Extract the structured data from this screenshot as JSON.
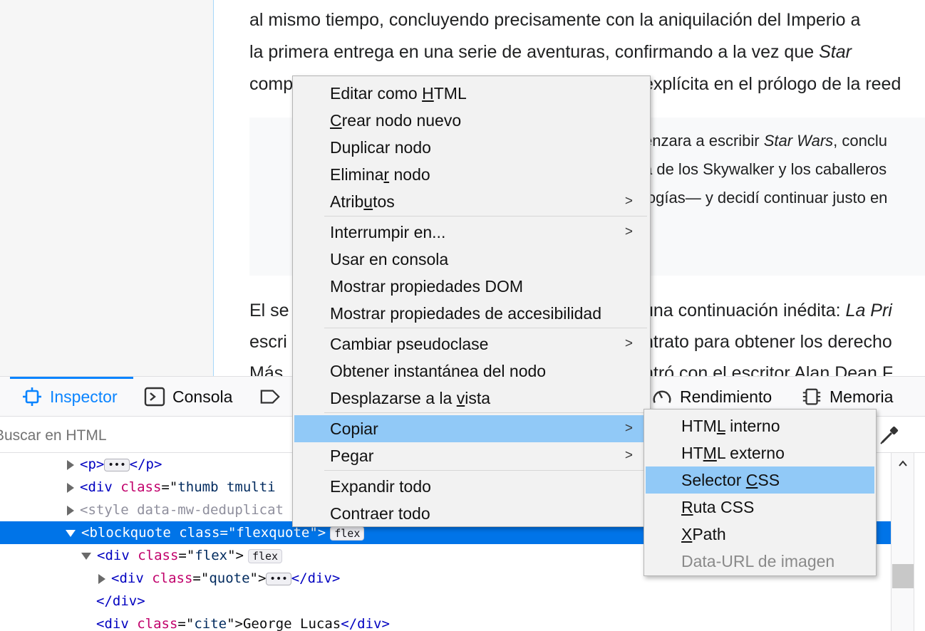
{
  "page": {
    "lines": [
      "al mismo tiempo, concluyendo precisamente con la aniquilación del Imperio a",
      "la primera entrega en una serie de aventuras, confirmando a la vez que",
      "comp",
      "explícita en el prólogo de la reed"
    ],
    "line2_italic": "Star",
    "quote_lines": [
      {
        "pre": "enzara a escribir ",
        "em": "Star Wars",
        "post": ", conclu"
      },
      {
        "pre": "a de los Skywalker y los caballeros",
        "em": "",
        "post": ""
      },
      {
        "pre": "logías— y decidí continuar justo en",
        "em": "",
        "post": ""
      }
    ],
    "after_lines": [
      {
        "left": "El se",
        "right": "una continuación inédita: ",
        "em": "La Pri"
      },
      {
        "left": "escri",
        "right": "ntrato para obtener los derecho",
        "em": ""
      },
      {
        "left": "Más",
        "right": "ntró con el escritor Alan Dean F",
        "em": ""
      }
    ]
  },
  "devtools": {
    "tabs": [
      {
        "label": "Inspector",
        "icon": "inspector-icon",
        "active": true
      },
      {
        "label": "Consola",
        "icon": "console-icon",
        "active": false
      },
      {
        "label": "",
        "icon": "debugger-icon",
        "active": false
      },
      {
        "label": "Rendimiento",
        "icon": "performance-icon",
        "active": false
      },
      {
        "label": "Memoria",
        "icon": "memory-icon",
        "active": false
      }
    ],
    "search_placeholder": "Buscar en HTML",
    "markup": {
      "row0": {
        "open": "<",
        "tag": "p",
        "close": ">",
        "endtag": "</p>"
      },
      "row1": {
        "tag": "<div",
        "attr": "class",
        "eq": "=\"",
        "val": "thumb tmulti"
      },
      "row2": {
        "text": "<style data-mw-deduplicat"
      },
      "row3": {
        "tag": "<blockquote",
        "attr": "class",
        "eq": "=\"",
        "val": "flexquote",
        "rest": "\">",
        "badge": "flex"
      },
      "row4": {
        "tag": "<div",
        "attr": "class",
        "eq": "=\"",
        "val": "flex",
        "rest": "\">",
        "badge": "flex"
      },
      "row5": {
        "tag": "<div",
        "attr": "class",
        "eq": "=\"",
        "val": "quote",
        "rest": "\">",
        "end": "</div>"
      },
      "row6": {
        "end": "</div>"
      },
      "row7": {
        "tag": "<div",
        "attr": "class",
        "eq": "=\"",
        "val": "cite",
        "rest": "\">",
        "text": "George Lucas",
        "end": "</div>"
      }
    },
    "ellipsis": "•••"
  },
  "context_menu": {
    "groups": [
      [
        {
          "pre": "Editar como ",
          "u": "H",
          "post": "TML"
        },
        {
          "pre": "",
          "u": "C",
          "post": "rear nodo nuevo"
        },
        {
          "pre": "Duplicar nodo",
          "u": "",
          "post": ""
        },
        {
          "pre": "Elimina",
          "u": "r",
          "post": " nodo"
        },
        {
          "pre": "Atrib",
          "u": "u",
          "post": "tos",
          "submenu": true
        }
      ],
      [
        {
          "pre": "Interrumpir en...",
          "u": "",
          "post": "",
          "submenu": true
        },
        {
          "pre": "Usar en consola",
          "u": "",
          "post": ""
        },
        {
          "pre": "Mostrar propiedades DOM",
          "u": "",
          "post": ""
        },
        {
          "pre": "Mostrar propiedades de accesibilidad",
          "u": "",
          "post": ""
        }
      ],
      [
        {
          "pre": "Cambiar pseudoclase",
          "u": "",
          "post": "",
          "submenu": true
        },
        {
          "pre": "Obtener instantánea del nodo",
          "u": "",
          "post": ""
        },
        {
          "pre": "Desplazarse a la ",
          "u": "v",
          "post": "ista"
        }
      ],
      [
        {
          "pre": "Copiar",
          "u": "",
          "post": "",
          "submenu": true,
          "highlighted": true
        },
        {
          "pre": "Pegar",
          "u": "",
          "post": "",
          "submenu": true
        }
      ],
      [
        {
          "pre": "Expandir todo",
          "u": "",
          "post": ""
        },
        {
          "pre": "Contraer todo",
          "u": "",
          "post": ""
        }
      ]
    ],
    "submenu_arrow": ">"
  },
  "copy_submenu": {
    "items": [
      {
        "pre": "HTM",
        "u": "L",
        "post": " interno"
      },
      {
        "pre": "HT",
        "u": "M",
        "post": "L externo"
      },
      {
        "pre": "Selector ",
        "u": "C",
        "post": "SS",
        "highlighted": true
      },
      {
        "pre": "",
        "u": "R",
        "post": "uta CSS"
      },
      {
        "pre": "",
        "u": "X",
        "post": "Path"
      },
      {
        "pre": "Data-URL de imagen",
        "u": "",
        "post": "",
        "disabled": true
      }
    ]
  },
  "colors": {
    "accent": "#0a84ff",
    "selection": "#0074e8",
    "menu_highlight": "#91c9f7",
    "menu_bg": "#f2f2f2"
  }
}
